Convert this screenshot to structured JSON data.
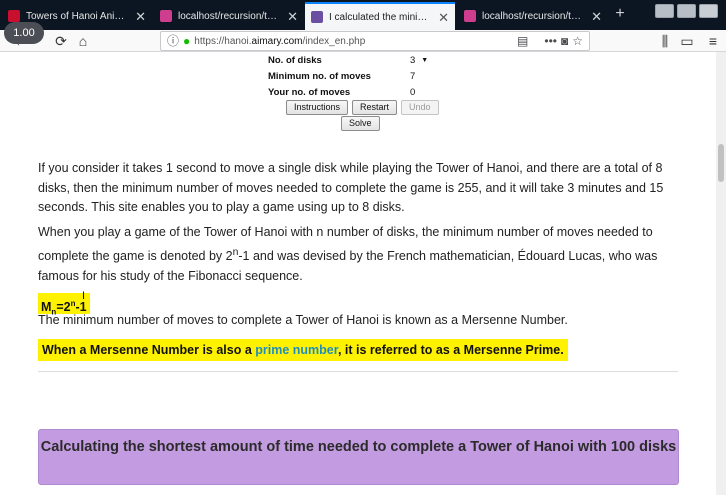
{
  "browser": {
    "tabs": [
      {
        "title": "Towers of Hanoi Animation",
        "favicon_color": "#c8102e",
        "active": false
      },
      {
        "title": "localhost/recursion/towers_o",
        "favicon_color": "#cf3d8f",
        "active": false
      },
      {
        "title": "I calculated the minimum an",
        "favicon_color": "#6b4fa3",
        "active": true
      },
      {
        "title": "localhost/recursion/towers_o",
        "favicon_color": "#cf3d8f",
        "active": false
      }
    ],
    "new_tab_label": "+",
    "zoom_badge": "1.00",
    "url_prefix": "https://hanoi.",
    "url_domain": "aimary.com",
    "url_path": "/index_en.php",
    "icons": {
      "back": "←",
      "reload": "⟳",
      "home": "⌂",
      "info": "ⓘ",
      "lock": "🔒",
      "reader": "▤",
      "more": "•••",
      "pocket": "◙",
      "star": "☆",
      "library": "⫼",
      "sidebar": "▭",
      "menu": "≡"
    }
  },
  "game": {
    "disks_label": "No. of disks",
    "disks_value": "3",
    "min_moves_label": "Minimum no. of moves",
    "min_moves_value": "7",
    "your_moves_label": "Your no. of moves",
    "your_moves_value": "0",
    "buttons": {
      "instructions": "Instructions",
      "restart": "Restart",
      "undo": "Undo",
      "solve": "Solve"
    }
  },
  "content": {
    "para1": "If you consider it takes 1 second to move a single disk while playing the Tower of Hanoi, and there are a total of 8 disks, then the minimum number of moves needed to complete the game is 255, and it will take 3 minutes and 15 seconds. This site enables you to play a game using up to 8 disks.",
    "para2_a": "When you play a game of the Tower of Hanoi with n number of disks, the minimum number of moves needed to complete the game is denoted by 2",
    "para2_sup": "n",
    "para2_b": "-1 and was devised by the French mathematician, Édouard Lucas, who was famous for his study of the Fibonacci sequence.",
    "formula_m": "M",
    "formula_sub": "n",
    "formula_eq": "=2",
    "formula_sup": "n",
    "formula_tail": "-1",
    "para3": "The minimum number of moves to complete a Tower of Hanoi is known as a Mersenne Number.",
    "highlight_a": "When a Mersenne Number is also a ",
    "highlight_link": "prime number",
    "highlight_b": ", it is referred to as a Mersenne Prime.",
    "banner": "Calculating the shortest amount of time needed to complete a Tower of Hanoi with 100 disks"
  }
}
